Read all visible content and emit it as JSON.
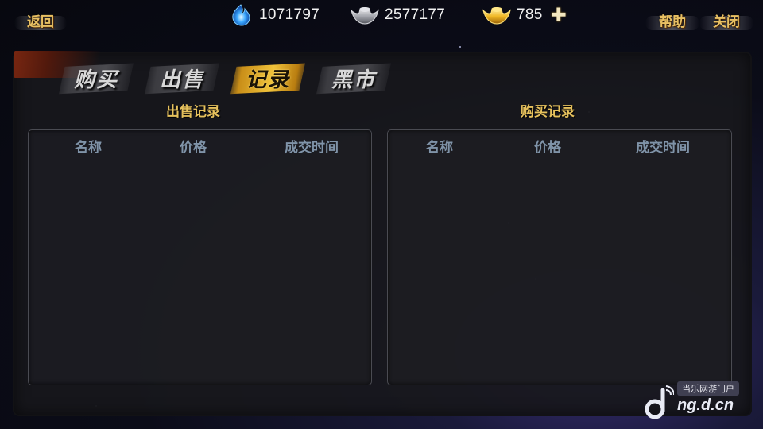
{
  "topbar": {
    "back_label": "返回",
    "help_label": "帮助",
    "close_label": "关闭",
    "spirit_value": "1071797",
    "silver_value": "2577177",
    "gold_value": "785",
    "add_symbol": "✚"
  },
  "tabs": [
    {
      "label": "购买",
      "active": false
    },
    {
      "label": "出售",
      "active": false
    },
    {
      "label": "记录",
      "active": true
    },
    {
      "label": "黑市",
      "active": false
    }
  ],
  "sell_record": {
    "title": "出售记录",
    "columns": [
      "名称",
      "价格",
      "成交时间"
    ],
    "rows": []
  },
  "buy_record": {
    "title": "购买记录",
    "columns": [
      "名称",
      "价格",
      "成交时间"
    ],
    "rows": []
  },
  "watermark": {
    "tag": "当乐网游门户",
    "url": "ng.d.cn"
  },
  "colors": {
    "gold_text": "#e6c15d",
    "header_text": "#7f93a8",
    "active_tab": "#f0c23a"
  },
  "icons": {
    "spirit": "blue-flame-icon",
    "silver": "silver-ingot-icon",
    "gold": "gold-ingot-icon",
    "add": "plus-icon"
  }
}
